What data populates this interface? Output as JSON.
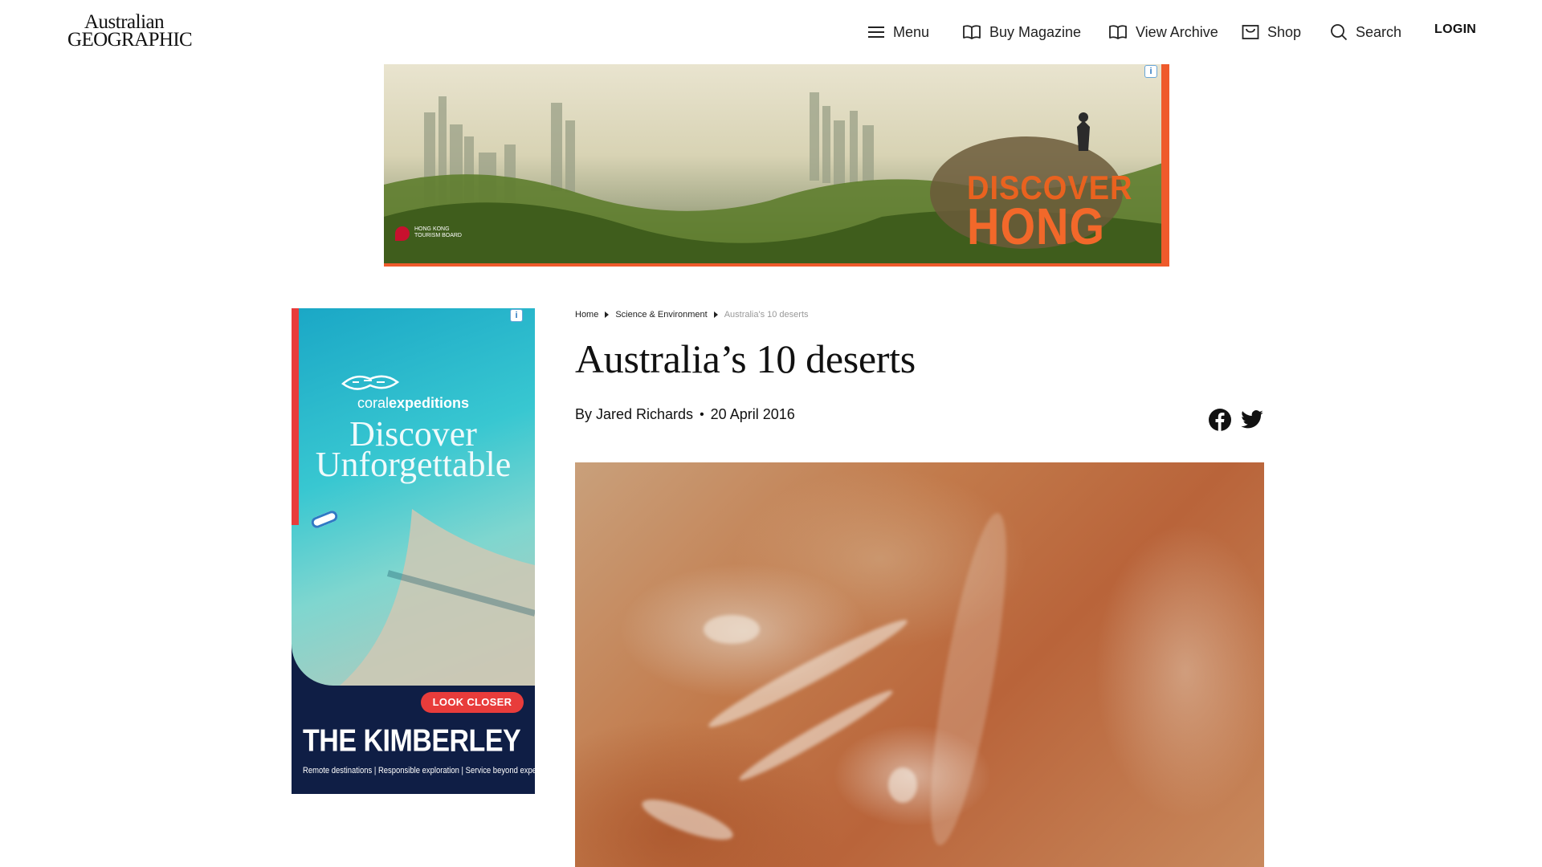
{
  "header": {
    "logo_line1": "Australian",
    "logo_line2": "GEOGRAPHIC",
    "nav": [
      {
        "label": "Menu",
        "icon": "hamburger-icon"
      },
      {
        "label": "Buy Magazine",
        "icon": "open-book-icon"
      },
      {
        "label": "View Archive",
        "icon": "open-book-icon"
      },
      {
        "label": "Shop",
        "icon": "shopping-bag-icon"
      },
      {
        "label": "Search",
        "icon": "search-icon"
      }
    ],
    "login": "LOGIN"
  },
  "top_ad": {
    "line1": "DISCOVER",
    "line2": "HONG KONG",
    "board": "HONG KONG TOURISM BOARD",
    "colors": {
      "accent": "#ef5a2b"
    }
  },
  "side_ad": {
    "brand_prefix": "coral",
    "brand_suffix": "expeditions",
    "headline_1": "Discover",
    "headline_2": "Unforgettable",
    "cta": "LOOK CLOSER",
    "title": "THE KIMBERLEY",
    "tagline": "Remote destinations | Responsible exploration | Service beyond expectation",
    "colors": {
      "navy": "#0f1e45",
      "cta": "#e83c3b"
    }
  },
  "breadcrumb": {
    "items": [
      "Home",
      "Science & Environment"
    ],
    "current": "Australia's 10 deserts"
  },
  "article": {
    "title": "Australia’s 10 deserts",
    "author": "By Jared Richards",
    "date": "20 April 2016",
    "share": [
      "facebook-icon",
      "twitter-icon"
    ]
  }
}
